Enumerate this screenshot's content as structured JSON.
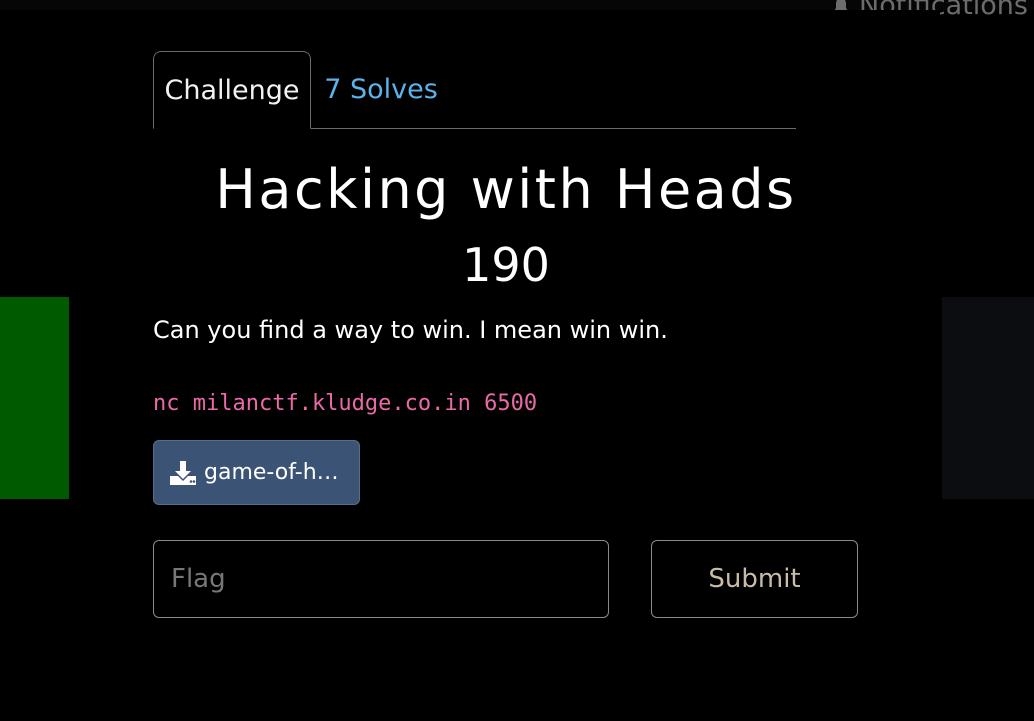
{
  "header": {
    "notifications_label": "Notifications"
  },
  "tabs": [
    {
      "label": "Challenge",
      "active": true
    },
    {
      "label": "7 Solves",
      "active": false
    }
  ],
  "challenge": {
    "title": "Hacking with Heads",
    "points": "190",
    "description": "Can you find a way to win. I mean win win.",
    "connection": "nc milanctf.kludge.co.in 6500",
    "file_label": "game-of-h…"
  },
  "form": {
    "flag_placeholder": "Flag",
    "submit_label": "Submit"
  },
  "colors": {
    "link": "#5bb3ea",
    "code": "#e96aa6",
    "file_button": "#3b5374",
    "submit_text": "#c7bca6"
  },
  "icons": {
    "notifications": "bell-icon",
    "file": "download-icon"
  }
}
